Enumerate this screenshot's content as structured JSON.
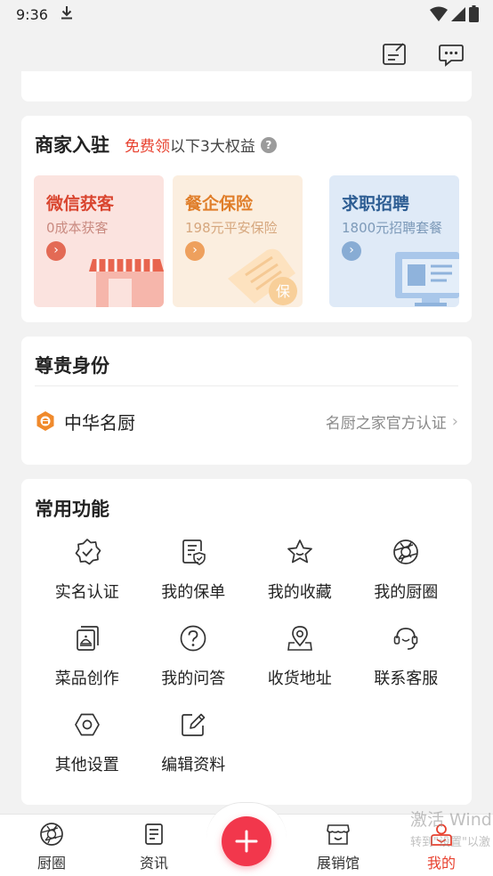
{
  "status_bar": {
    "time": "9:36"
  },
  "merchant": {
    "title": "商家入驻",
    "subtitle_highlight": "免费领",
    "subtitle_rest": "以下3大权益",
    "benefits": [
      {
        "title": "微信获客",
        "desc": "0成本获客"
      },
      {
        "title": "餐企保险",
        "desc": "198元平安保险"
      },
      {
        "title": "求职招聘",
        "desc": "1800元招聘套餐"
      }
    ],
    "insurance_stamp": "保"
  },
  "vip": {
    "title": "尊贵身份",
    "name": "中华名厨",
    "certification": "名厨之家官方认证"
  },
  "functions": {
    "title": "常用功能",
    "items": [
      {
        "label": "实名认证",
        "icon": "verified-badge-icon"
      },
      {
        "label": "我的保单",
        "icon": "policy-document-icon"
      },
      {
        "label": "我的收藏",
        "icon": "star-icon"
      },
      {
        "label": "我的厨圈",
        "icon": "aperture-circle-icon"
      },
      {
        "label": "菜品创作",
        "icon": "dish-create-icon"
      },
      {
        "label": "我的问答",
        "icon": "question-icon"
      },
      {
        "label": "收货地址",
        "icon": "location-pin-icon"
      },
      {
        "label": "联系客服",
        "icon": "headset-icon"
      },
      {
        "label": "其他设置",
        "icon": "settings-hexagon-icon"
      },
      {
        "label": "编辑资料",
        "icon": "edit-icon"
      }
    ]
  },
  "bottom_nav": {
    "items": [
      {
        "label": "厨圈"
      },
      {
        "label": "资讯"
      },
      {
        "label": "展销馆"
      },
      {
        "label": "我的"
      }
    ]
  },
  "watermark": {
    "line1": "激活 Wind",
    "line2": "转到\"设置\"以激"
  },
  "colors": {
    "accent": "#e8412f",
    "fab": "#f2374c"
  }
}
